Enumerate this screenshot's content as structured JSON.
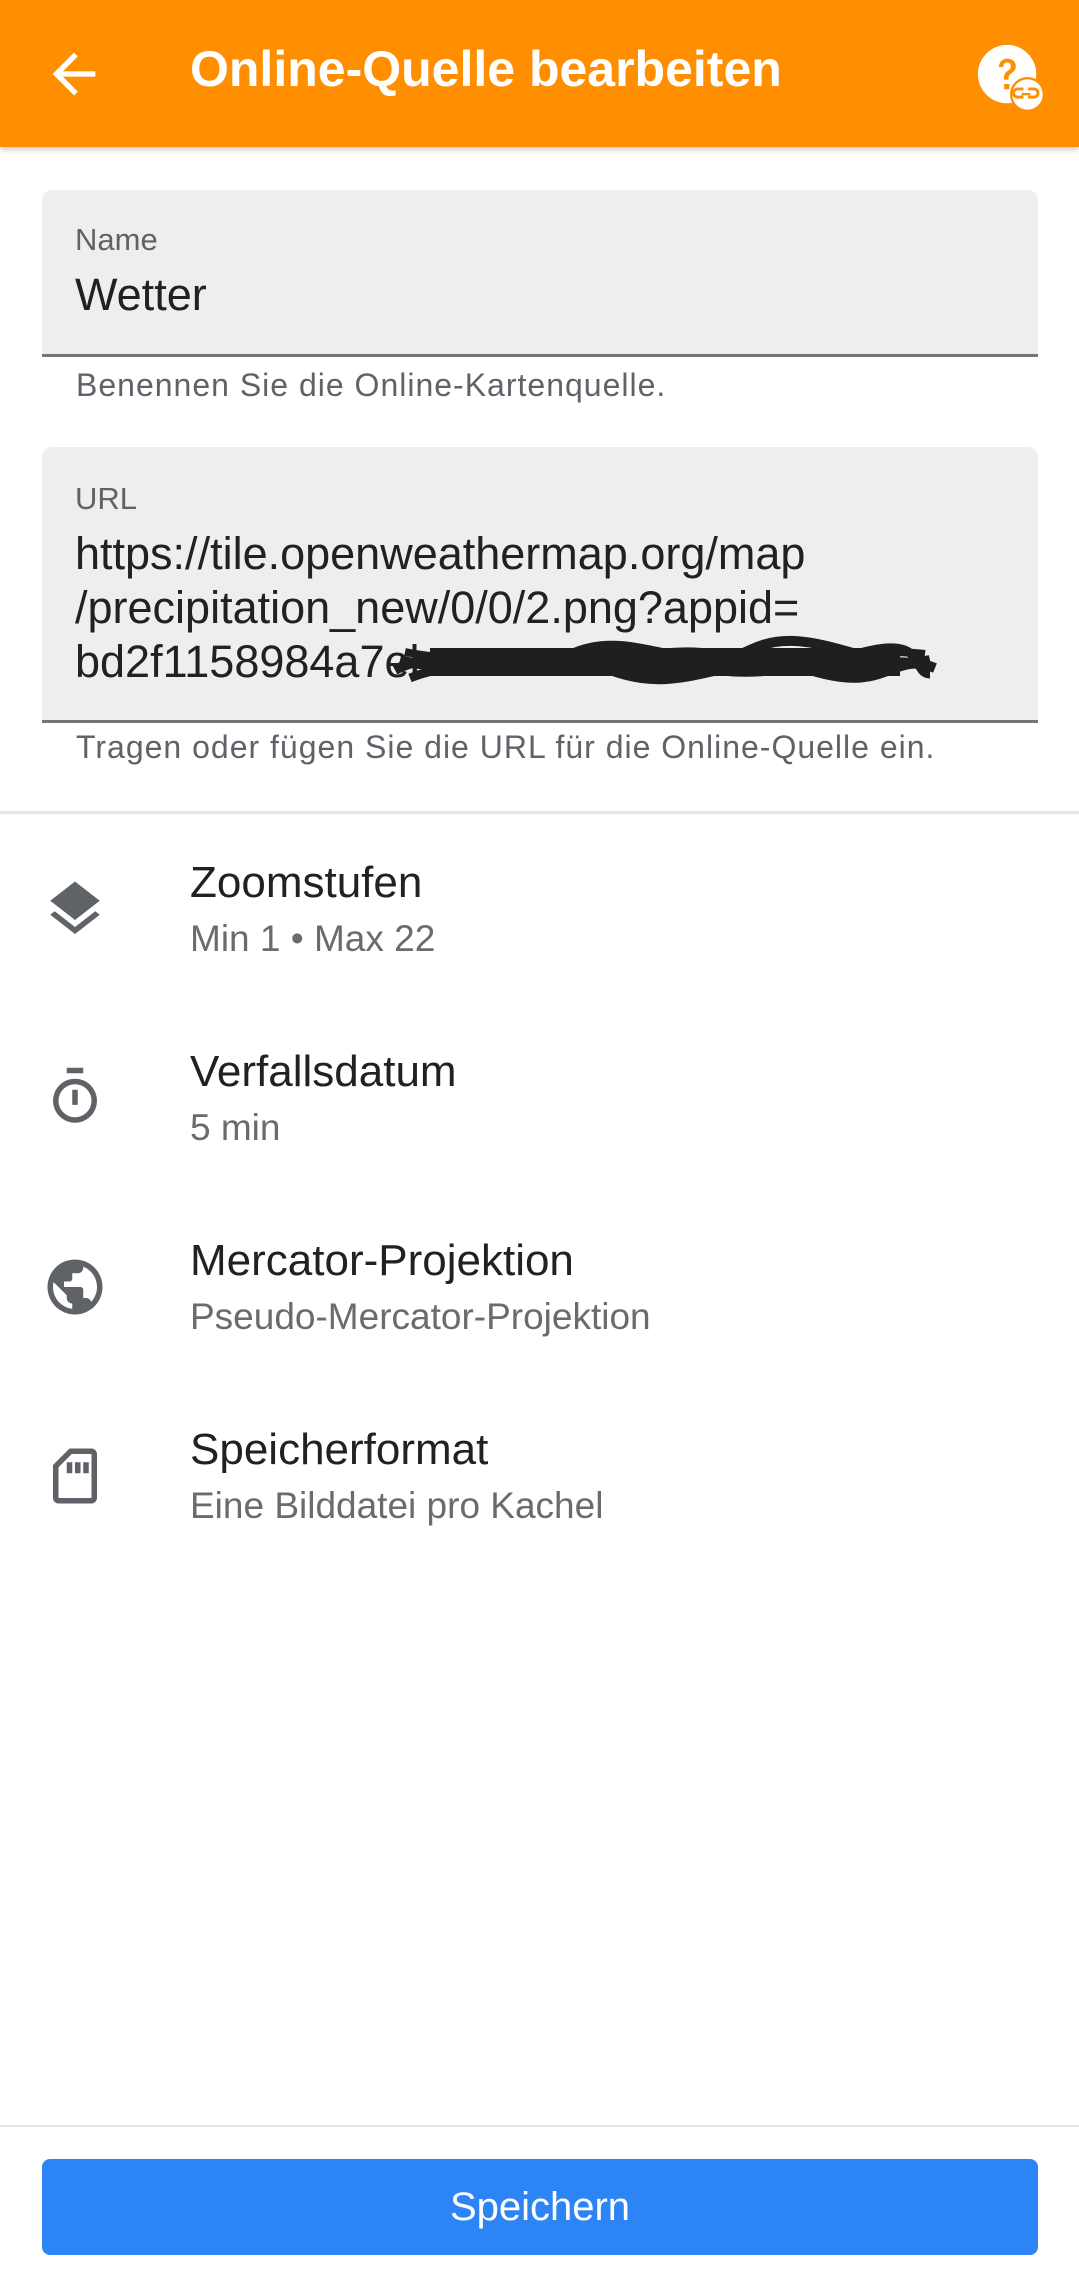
{
  "appbar": {
    "title": "Online-Quelle bearbeiten",
    "back_icon": "arrow-left",
    "help_icon": "help-link",
    "color": "#FF8E00"
  },
  "name_field": {
    "label": "Name",
    "value": "Wetter",
    "helper": "Benennen Sie die Online-Kartenquelle."
  },
  "url_field": {
    "label": "URL",
    "value_line1": "https://tile.openweathermap.org/map",
    "value_line2": "/precipitation_new/0/0/2.png?appid=",
    "value_line3": "bd2f1158984a7eb",
    "helper": "Tragen oder fügen Sie die URL für die Online-Quelle ein."
  },
  "settings": [
    {
      "icon": "layers-icon",
      "title": "Zoomstufen",
      "subtitle": "Min 1 • Max 22"
    },
    {
      "icon": "timer-icon",
      "title": "Verfallsdatum",
      "subtitle": "5 min"
    },
    {
      "icon": "globe-icon",
      "title": "Mercator-Projektion",
      "subtitle": "Pseudo-Mercator-Projektion"
    },
    {
      "icon": "sd-card-icon",
      "title": "Speicherformat",
      "subtitle": "Eine Bilddatei pro Kachel"
    }
  ],
  "footer": {
    "save_label": "Speichern",
    "button_color": "#2D84F5"
  }
}
